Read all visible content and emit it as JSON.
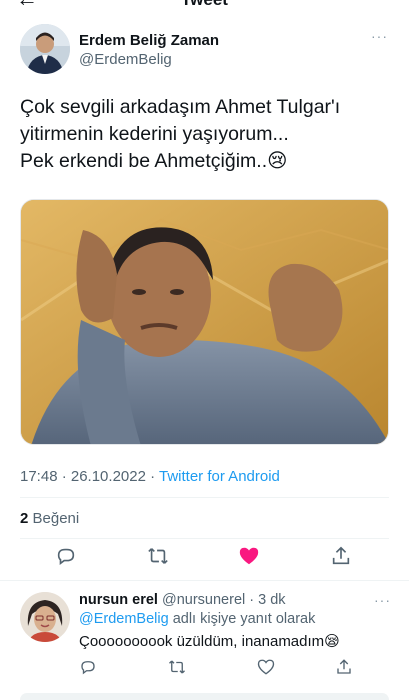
{
  "header": {
    "back_icon": "back-arrow-icon",
    "title": "Tweet"
  },
  "tweet": {
    "author_name": "Erdem Beliğ Zaman",
    "author_handle": "@ErdemBelig",
    "more": "···",
    "text_lines": [
      "Çok sevgili arkadaşım Ahmet Tulgar'ı",
      "yitirmenin kederini yaşıyorum...",
      "Pek erkendi be Ahmetçiğim..😢"
    ],
    "time": "17:48 · 26.10.2022 · ",
    "source": "Twitter for Android",
    "likes_count": "2",
    "likes_label": "Beğeni",
    "actions": [
      "reply-icon",
      "retweet-icon",
      "like-icon-filled",
      "share-icon"
    ],
    "like_color": "#f91880"
  },
  "reply": {
    "name": "nursun erel",
    "handle_time": "@nursunerel · 3 dk",
    "reply_to_mention": "@ErdemBelig",
    "reply_to_suffix": " adlı kişiye yanıt olarak",
    "text": "Çoooooooook üzüldüm, inanamadım😪",
    "more": "···"
  }
}
